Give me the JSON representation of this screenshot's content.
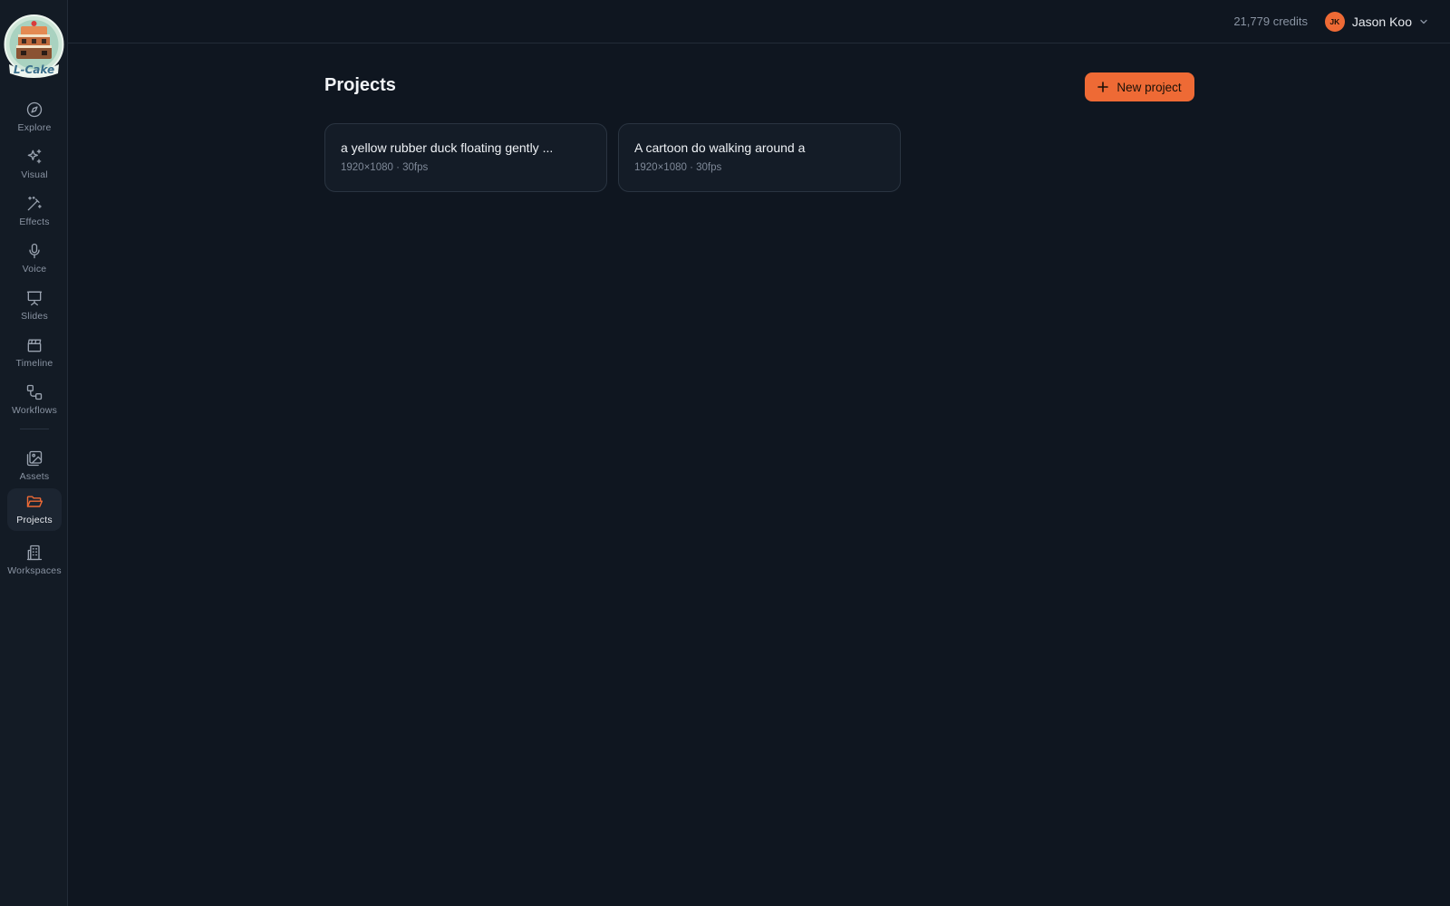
{
  "brand": {
    "logo_text": "L-Cake"
  },
  "sidebar": {
    "items": [
      {
        "label": "Explore",
        "icon": "compass-icon",
        "active": false
      },
      {
        "label": "Visual",
        "icon": "sparkles-icon",
        "active": false
      },
      {
        "label": "Effects",
        "icon": "magic-wand-icon",
        "active": false
      },
      {
        "label": "Voice",
        "icon": "microphone-icon",
        "active": false
      },
      {
        "label": "Slides",
        "icon": "presentation-icon",
        "active": false
      },
      {
        "label": "Timeline",
        "icon": "clapperboard-icon",
        "active": false
      },
      {
        "label": "Workflows",
        "icon": "workflow-icon",
        "active": false
      },
      {
        "label": "Assets",
        "icon": "images-icon",
        "active": false
      },
      {
        "label": "Projects",
        "icon": "folder-open-icon",
        "active": true
      },
      {
        "label": "Workspaces",
        "icon": "building-icon",
        "active": false
      }
    ]
  },
  "topbar": {
    "credits": "21,779 credits",
    "user": {
      "initials": "JK",
      "name": "Jason Koo"
    }
  },
  "main": {
    "title": "Projects",
    "new_project_label": "New project",
    "projects": [
      {
        "title": "a yellow rubber duck floating gently ...",
        "meta": "1920×1080 · 30fps"
      },
      {
        "title": "A cartoon do walking around a",
        "meta": "1920×1080 · 30fps"
      }
    ]
  },
  "colors": {
    "background": "#0f1620",
    "sidebar": "#131b25",
    "accent": "#ee6a35",
    "muted_text": "#8a94a3"
  }
}
